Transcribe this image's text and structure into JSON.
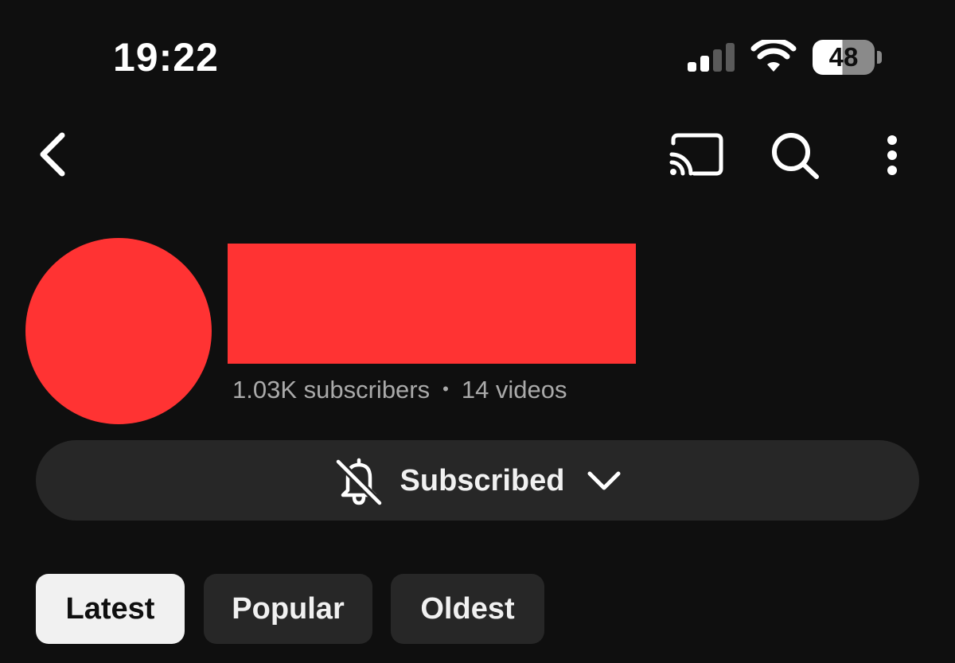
{
  "status_bar": {
    "time": "19:22",
    "battery_level": "48",
    "icons": [
      "signal-icon",
      "wifi-icon",
      "battery-icon"
    ]
  },
  "top_bar": {
    "icons": [
      "back-icon",
      "cast-icon",
      "search-icon",
      "more-vert-icon"
    ]
  },
  "channel": {
    "subscribers": "1.03K subscribers",
    "separator": "•",
    "videos": "14 videos"
  },
  "subscribe_button": {
    "label": "Subscribed",
    "icons": [
      "bell-off-icon",
      "chevron-down-icon"
    ]
  },
  "filters": {
    "chips": [
      {
        "label": "Latest",
        "active": true
      },
      {
        "label": "Popular",
        "active": false
      },
      {
        "label": "Oldest",
        "active": false
      }
    ]
  },
  "colors": {
    "background": "#0f0f0f",
    "surface": "#272727",
    "redaction": "#ff3333",
    "text_primary": "#f1f1f1",
    "text_secondary": "#aaaaaa"
  }
}
